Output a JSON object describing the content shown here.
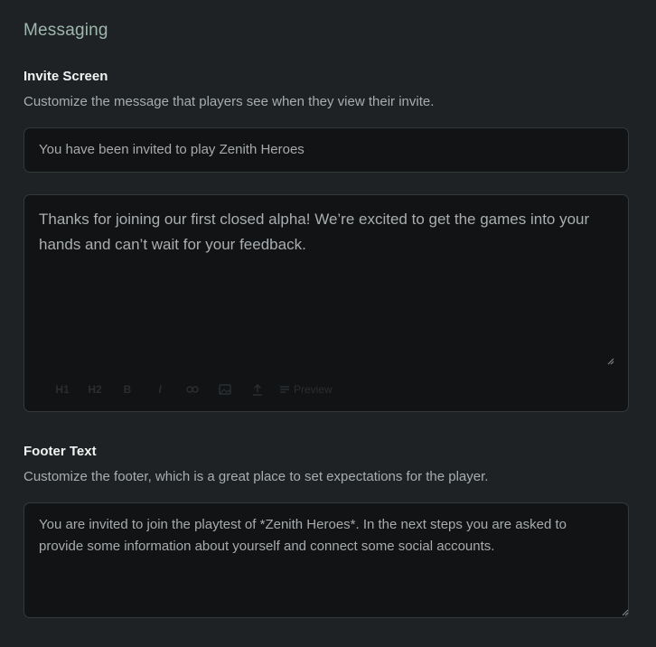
{
  "messaging": {
    "section_title": "Messaging",
    "invite_screen": {
      "heading": "Invite Screen",
      "description": "Customize the message that players see when they view their invite.",
      "title_value": "You have been invited to play Zenith Heroes",
      "body_value": "Thanks for joining our first closed alpha! We’re excited to get the games into your hands and can’t wait for your feedback.",
      "toolbar": {
        "h1": "H1",
        "h2": "H2",
        "bold": "B",
        "italic": "I",
        "preview_label": "Preview"
      }
    },
    "footer": {
      "heading": "Footer Text",
      "description": "Customize the footer, which is a great place to set expectations for the player.",
      "body_value": "You are invited to join the playtest of *Zenith Heroes*. In the next steps you are asked to provide some information about yourself and connect some social accounts."
    }
  }
}
